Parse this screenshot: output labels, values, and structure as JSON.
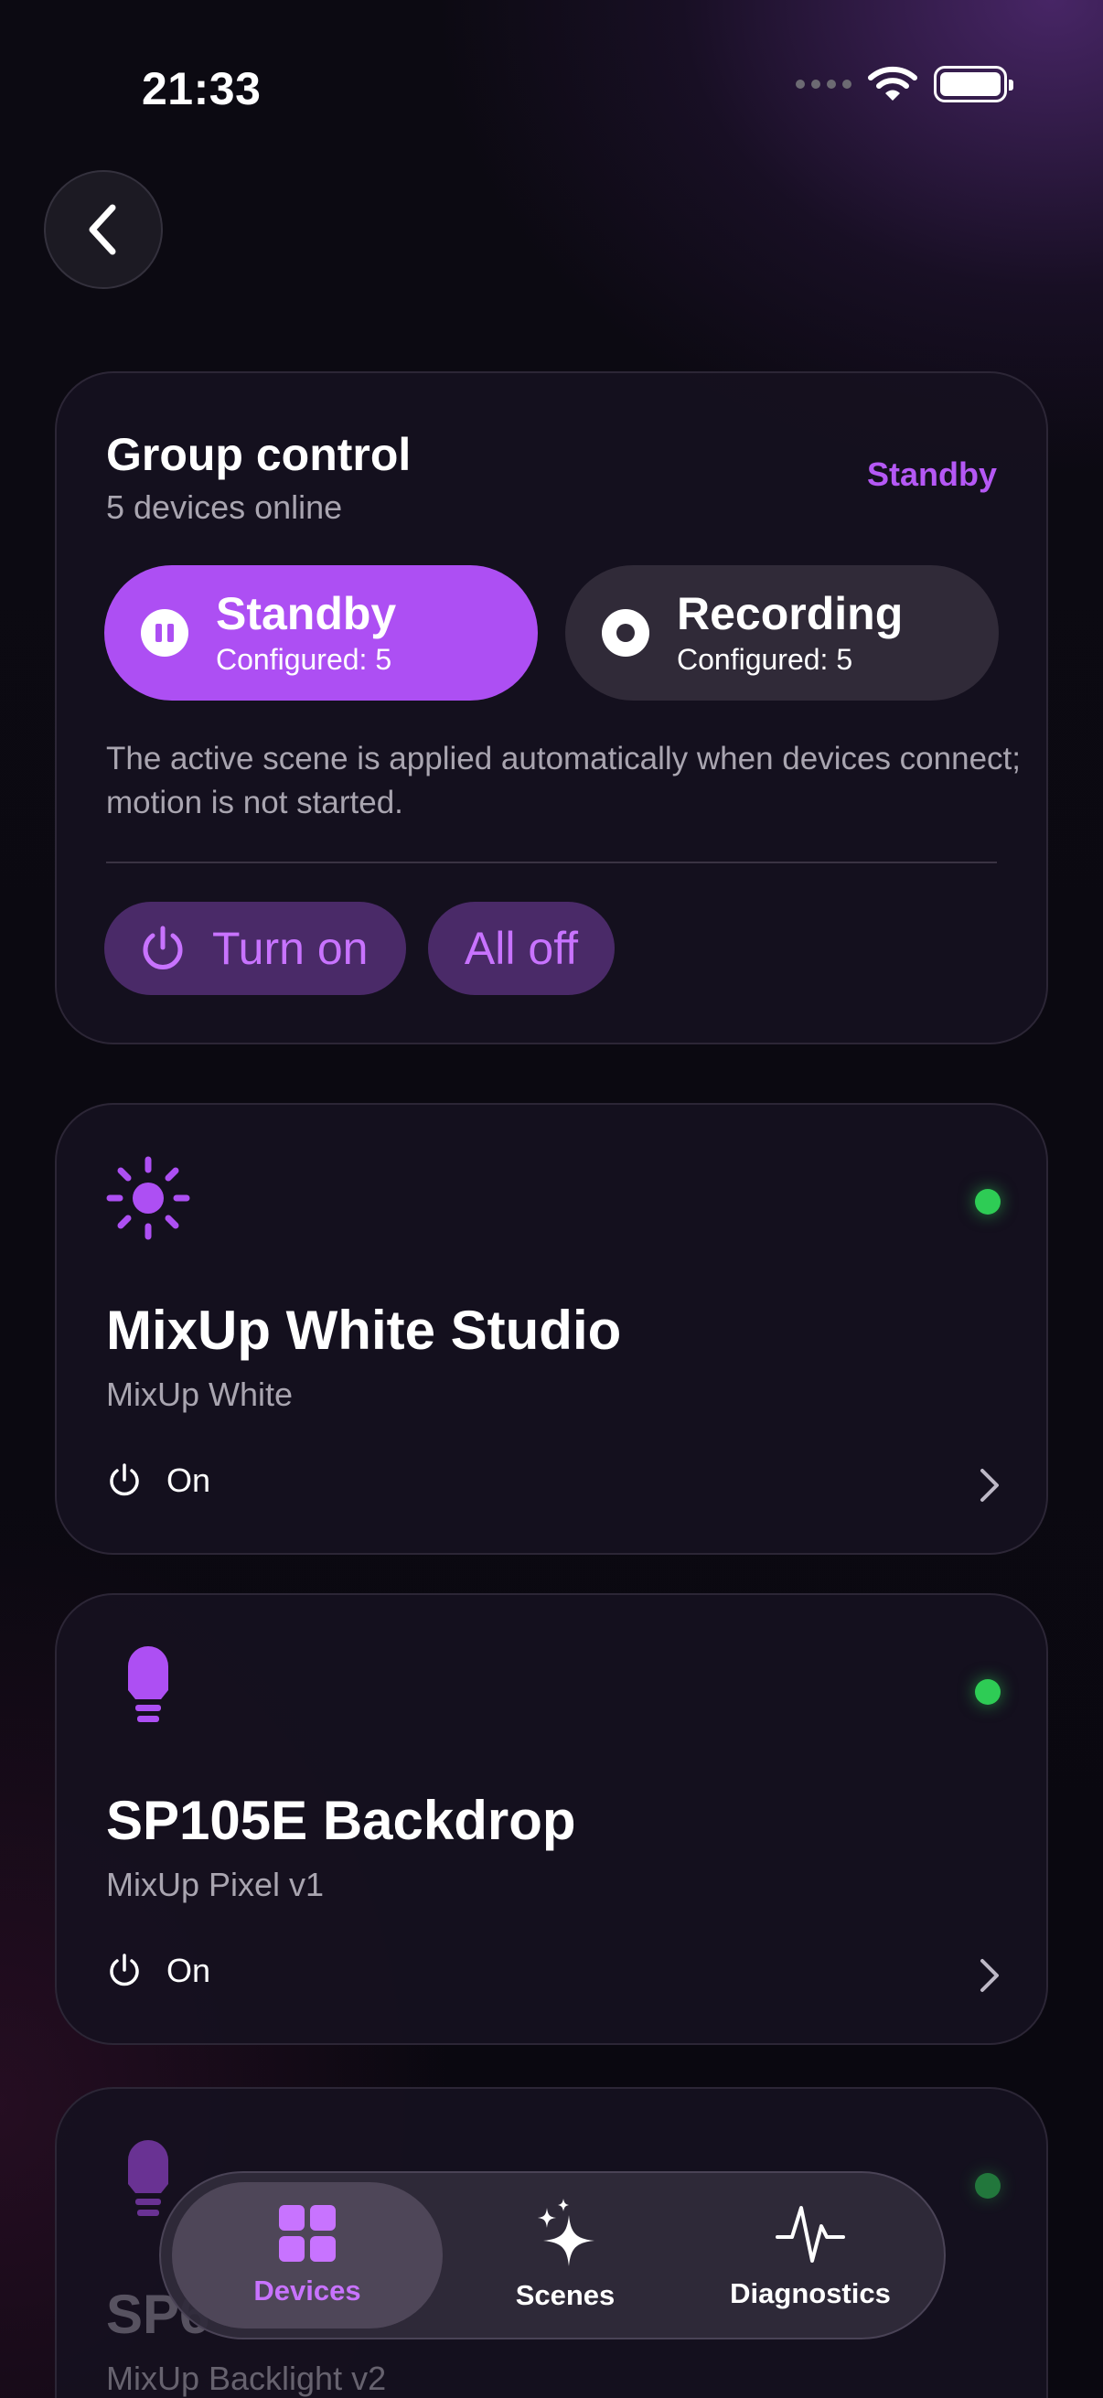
{
  "status_bar": {
    "time": "21:33"
  },
  "group_control": {
    "title": "Group control",
    "subtitle": "5 devices online",
    "status": "Standby",
    "modes": [
      {
        "label": "Standby",
        "sub": "Configured: 5",
        "active": true
      },
      {
        "label": "Recording",
        "sub": "Configured: 5",
        "active": false
      }
    ],
    "note": "The active scene is applied automatically when devices connect; motion is not started.",
    "turn_on_label": "Turn on",
    "all_off_label": "All off"
  },
  "devices": [
    {
      "name": "MixUp White Studio",
      "model": "MixUp White",
      "power": "On",
      "icon": "sun-icon",
      "online": true
    },
    {
      "name": "SP105E Backdrop",
      "model": "MixUp Pixel v1",
      "power": "On",
      "icon": "bulb-icon",
      "online": true
    },
    {
      "name": "SP6",
      "model": "MixUp Backlight v2",
      "icon": "bulb-icon",
      "online": true
    }
  ],
  "tab_bar": {
    "tabs": [
      {
        "label": "Devices",
        "icon": "grid-icon",
        "active": true
      },
      {
        "label": "Scenes",
        "icon": "sparkles-icon",
        "active": false
      },
      {
        "label": "Diagnostics",
        "icon": "pulse-icon",
        "active": false
      }
    ]
  },
  "colors": {
    "accent": "#ad4ff3",
    "accent_text": "#c873ff",
    "online": "#2ecc55",
    "background": "#0b0811"
  }
}
